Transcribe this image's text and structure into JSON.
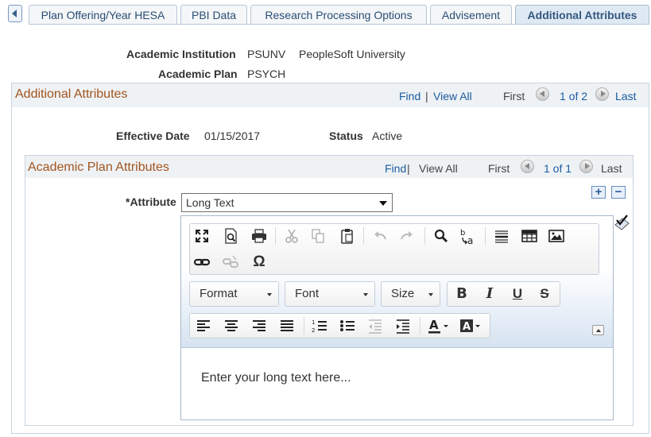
{
  "tabs": [
    {
      "label": "Plan Offering/Year HESA"
    },
    {
      "label": "PBI Data"
    },
    {
      "label": "Research Processing Options"
    },
    {
      "label": "Advisement"
    },
    {
      "label": "Additional Attributes",
      "active": true
    }
  ],
  "header": {
    "institution_label": "Academic Institution",
    "institution_code": "PSUNV",
    "institution_name": "PeopleSoft University",
    "plan_label": "Academic Plan",
    "plan_code": "PSYCH"
  },
  "additional_attributes": {
    "title": "Additional Attributes",
    "find": "Find",
    "sep": "|",
    "view_all": "View All",
    "first": "First",
    "pager": "1 of 2",
    "last": "Last",
    "effective_date_label": "Effective Date",
    "effective_date": "01/15/2017",
    "status_label": "Status",
    "status": "Active"
  },
  "plan_attributes": {
    "title": "Academic Plan Attributes",
    "find": "Find",
    "sep": "|",
    "view_all": "View All",
    "first": "First",
    "pager": "1 of 1",
    "last": "Last",
    "attribute_label": "*Attribute",
    "attribute_value": "Long Text",
    "add_symbol": "+",
    "remove_symbol": "−"
  },
  "editor": {
    "format_label": "Format",
    "font_label": "Font",
    "size_label": "Size",
    "bold": "B",
    "italic": "I",
    "underline": "U",
    "strike": "S",
    "omega": "Ω",
    "placeholder": "Enter your long text here..."
  }
}
